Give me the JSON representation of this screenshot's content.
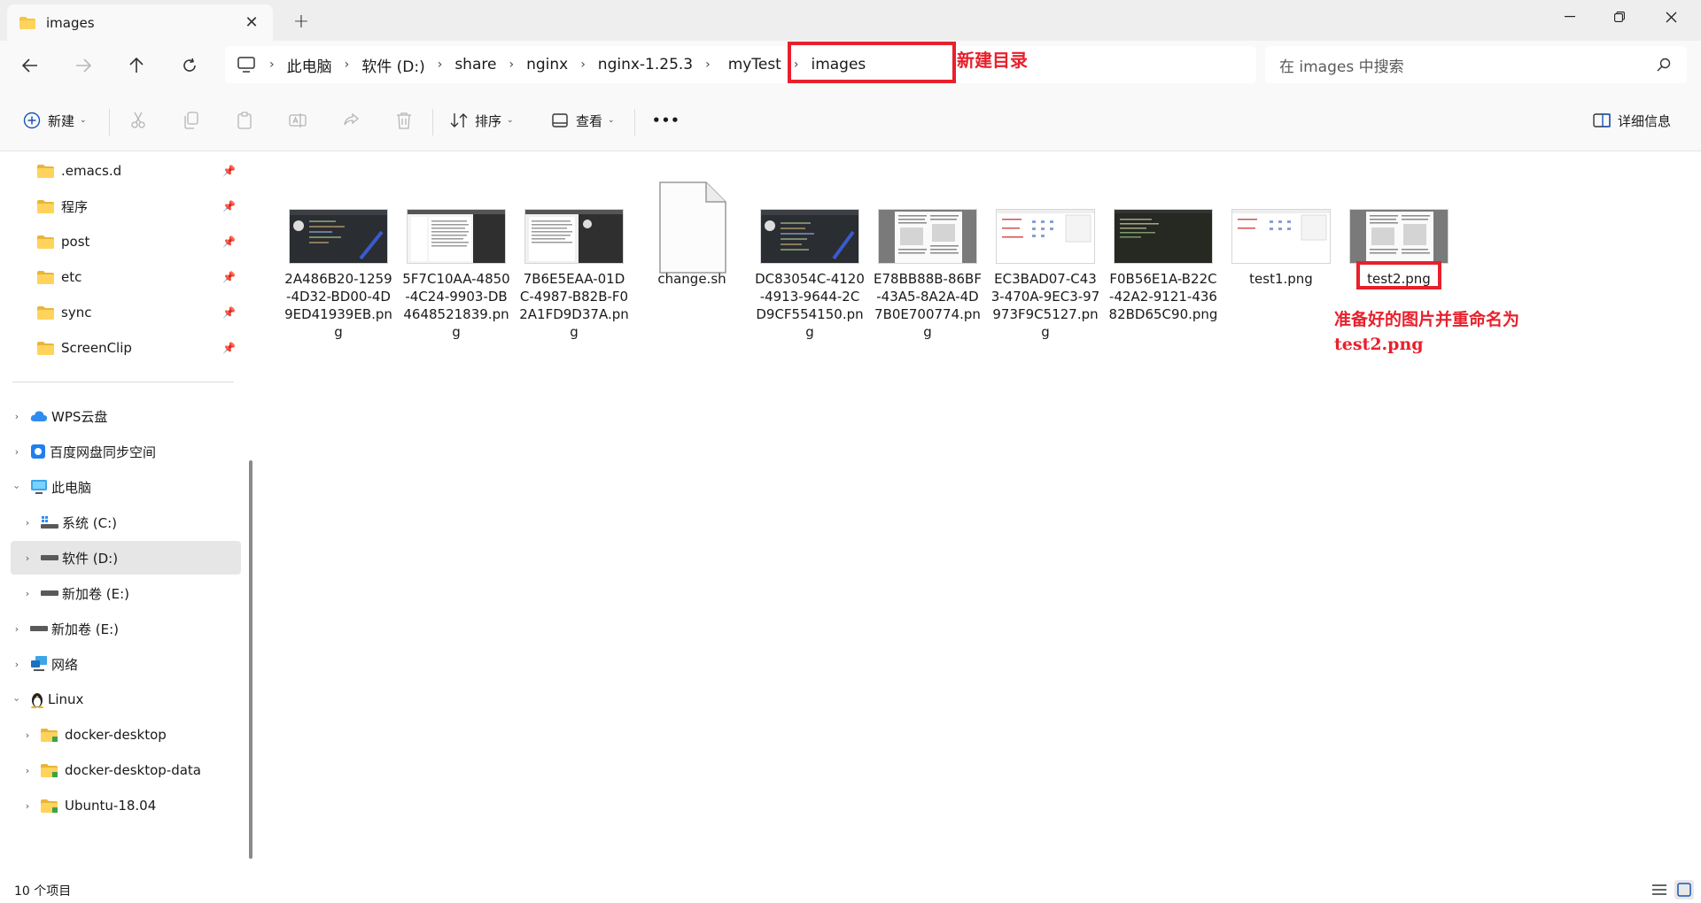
{
  "window": {
    "tab_title": "images",
    "tab_close": "✕",
    "new_tab": "+"
  },
  "address": {
    "crumbs": [
      "此电脑",
      "软件 (D:)",
      "share",
      "nginx",
      "nginx-1.25.3",
      "myTest",
      "images"
    ],
    "annotation": "新建目录"
  },
  "search": {
    "placeholder": "在 images 中搜索"
  },
  "toolbar": {
    "new_label": "新建",
    "sort_label": "排序",
    "view_label": "查看",
    "more_label": "•••",
    "details_label": "详细信息"
  },
  "sidebar": {
    "pinned": [
      ".emacs.d",
      "程序",
      "post",
      "etc",
      "sync",
      "ScreenClip"
    ],
    "tree": [
      {
        "label": "WPS云盘"
      },
      {
        "label": "百度网盘同步空间"
      },
      {
        "label": "此电脑"
      },
      {
        "label": "系统 (C:)"
      },
      {
        "label": "软件 (D:)"
      },
      {
        "label": "新加卷 (E:)"
      },
      {
        "label": "新加卷 (E:)"
      },
      {
        "label": "网络"
      },
      {
        "label": "Linux"
      },
      {
        "label": "docker-desktop"
      },
      {
        "label": "docker-desktop-data"
      },
      {
        "label": "Ubuntu-18.04"
      }
    ]
  },
  "files": [
    {
      "name": "2A486B20-1259-4D32-BD00-4D9ED41939EB.png",
      "thumb": "dark-editor"
    },
    {
      "name": "5F7C10AA-4850-4C24-9903-DB4648521839.png",
      "thumb": "doc-dark"
    },
    {
      "name": "7B6E5EAA-01DC-4987-B82B-F02A1FD9D37A.png",
      "thumb": "doc-dark"
    },
    {
      "name": "change.sh",
      "thumb": "blank-file"
    },
    {
      "name": "DC83054C-4120-4913-9644-2CD9CF554150.png",
      "thumb": "dark-editor"
    },
    {
      "name": "E78BB88B-86BF-43A5-8A2A-4D7B0E700774.png",
      "thumb": "paper"
    },
    {
      "name": "EC3BAD07-C433-470A-9EC3-97973F9C5127.png",
      "thumb": "web-light"
    },
    {
      "name": "F0B56E1A-B22C-42A2-9121-43682BD65C90.png",
      "thumb": "terminal"
    },
    {
      "name": "test1.png",
      "thumb": "web-light"
    },
    {
      "name": "test2.png",
      "thumb": "paper"
    }
  ],
  "file_annotation": "准备好的图片并重命名为\ntest2.png",
  "status": {
    "item_count": "10 个项目"
  }
}
